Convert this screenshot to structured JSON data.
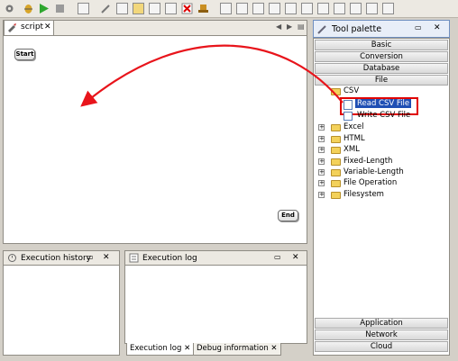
{
  "editor": {
    "tab_title": "script",
    "start_label": "Start",
    "end_label": "End"
  },
  "palette": {
    "title": "Tool palette",
    "categories_top": [
      "Basic",
      "Conversion",
      "Database",
      "File"
    ],
    "tree": {
      "csv": "CSV",
      "read_csv": "Read CSV File",
      "write_csv": "Write CSV File",
      "excel": "Excel",
      "html": "HTML",
      "xml": "XML",
      "fixed": "Fixed-Length",
      "variable": "Variable-Length",
      "fileop": "File Operation",
      "filesystem": "Filesystem"
    },
    "categories_bottom": [
      "Application",
      "Network",
      "Cloud"
    ]
  },
  "history": {
    "title": "Execution history"
  },
  "log": {
    "title": "Execution log",
    "tab1": "Execution log",
    "tab2": "Debug information"
  },
  "colors": {
    "highlight_border": "#e00000",
    "selection": "#1f4fb4",
    "arrow": "#e8141b"
  }
}
